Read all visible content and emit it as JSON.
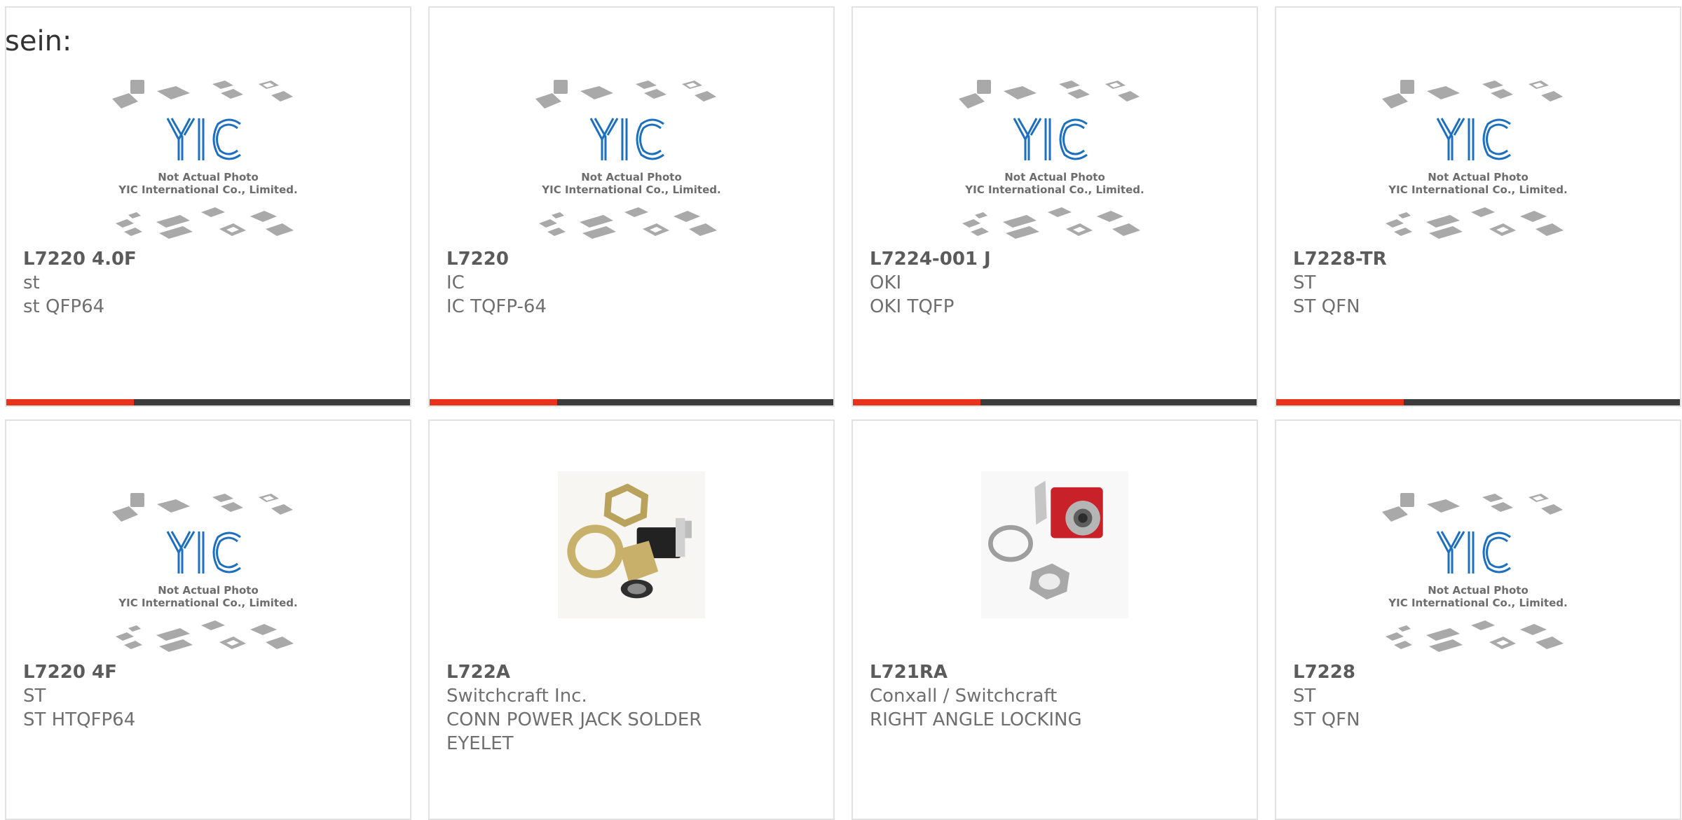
{
  "intro_text": "sein:",
  "colors": {
    "accent": "#e8321c",
    "bar": "#3c3c3c",
    "logo_blue": "#1d6fbf"
  },
  "placeholder": {
    "logo": "YIC",
    "line1": "Not Actual Photo",
    "line2": "YIC International Co., Limited."
  },
  "products": [
    {
      "part": "L7220 4.0F",
      "brand": "st",
      "desc": "st QFP64",
      "image": "yic-placeholder"
    },
    {
      "part": "L7220",
      "brand": "IC",
      "desc": "IC TQFP-64",
      "image": "yic-placeholder"
    },
    {
      "part": "L7224-001 J",
      "brand": "OKI",
      "desc": "OKI TQFP",
      "image": "yic-placeholder"
    },
    {
      "part": "L7228-TR",
      "brand": "ST",
      "desc": "ST QFN",
      "image": "yic-placeholder"
    },
    {
      "part": "L7220 4F",
      "brand": "ST",
      "desc": "ST HTQFP64",
      "image": "yic-placeholder"
    },
    {
      "part": "L722A",
      "brand": "Switchcraft Inc.",
      "desc": "CONN POWER JACK SOLDER EYELET",
      "image": "power-jack-photo"
    },
    {
      "part": "L721RA",
      "brand": "Conxall / Switchcraft",
      "desc": "RIGHT ANGLE LOCKING",
      "image": "red-jack-photo"
    },
    {
      "part": "L7228",
      "brand": "ST",
      "desc": "ST QFN",
      "image": "yic-placeholder"
    }
  ]
}
